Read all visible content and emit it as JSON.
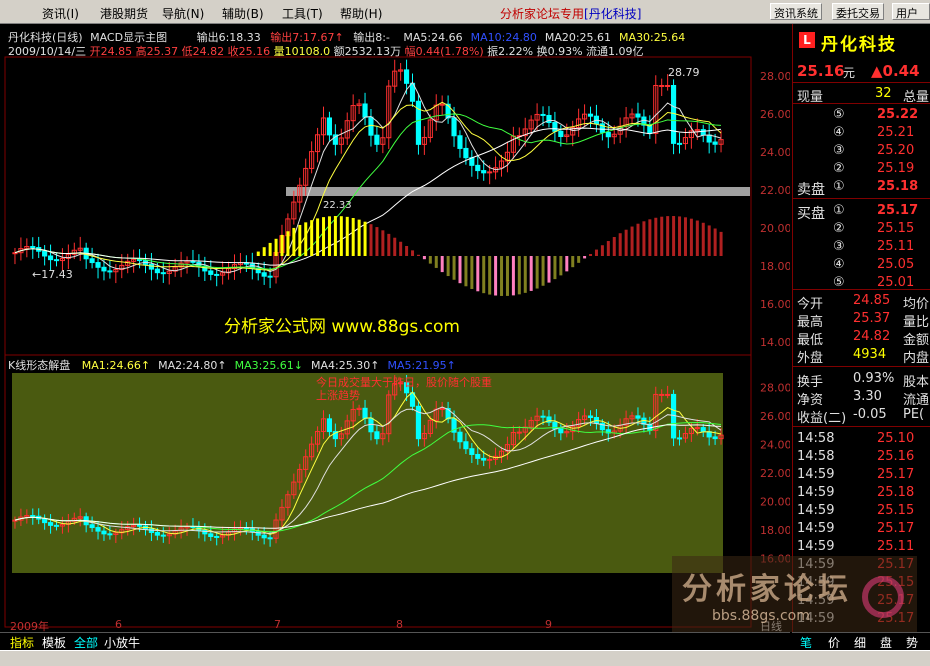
{
  "menu": {
    "items": [
      "资讯(I)",
      "港股期货",
      "导航(N)",
      "辅助(B)",
      "工具(T)",
      "帮助(H)"
    ],
    "forum_label": "分析家论坛专用",
    "stock_tag": "[丹化科技]",
    "buttons": [
      "资讯系统",
      "委托交易",
      "用户"
    ]
  },
  "upper": {
    "title": "丹化科技(日线)",
    "indicator": "MACD显示主图",
    "outputs": [
      "输出6:18.33",
      "输出7:17.67↑",
      "输出8:-"
    ],
    "ma": [
      {
        "label": "MA5:24.66",
        "color": "#e0e0e0"
      },
      {
        "label": "MA10:24.80",
        "color": "#3050ff"
      },
      {
        "label": "MA20:25.61",
        "color": "#e0e0e0"
      },
      {
        "label": "MA30:25.64",
        "color": "#ffff40"
      }
    ],
    "info_line": {
      "date": "2009/10/14/三",
      "open": "开24.85",
      "high": "高25.37",
      "low": "低24.82",
      "close": "收25.16",
      "vol": "量10108.0",
      "amount": "额2532.13万",
      "change": "幅0.44(1.78%)",
      "amp": "振2.22%",
      "turnover": "换0.93%",
      "float": "流通1.09亿"
    },
    "y_ticks": [
      "28.00",
      "26.00",
      "24.00",
      "22.00",
      "20.00",
      "18.00",
      "16.00",
      "14.00"
    ],
    "annotations": {
      "high": "28.79",
      "low": "←17.43",
      "mid": "22.33"
    },
    "watermark": "分析家公式网  www.88gs.com"
  },
  "lower": {
    "title": "K线形态解盘",
    "ma": [
      {
        "label": "MA1:24.66↑",
        "color": "#ffff40"
      },
      {
        "label": "MA2:24.80↑",
        "color": "#e0e0e0"
      },
      {
        "label": "MA3:25.61↓",
        "color": "#40ff40"
      },
      {
        "label": "MA4:25.30↑",
        "color": "#e0e0e0"
      },
      {
        "label": "MA5:21.95↑",
        "color": "#3050ff"
      }
    ],
    "note_lines": [
      "今日成交量大于昨日，股价随个股重",
      "上涨趋势"
    ],
    "y_ticks": [
      "28.00",
      "26.00",
      "24.00",
      "22.00",
      "20.00",
      "18.00",
      "16.00"
    ],
    "x_ticks": [
      "2009年",
      "6",
      "7",
      "8",
      "9"
    ],
    "period": "日线"
  },
  "quote": {
    "name": "丹化科技",
    "logo": "L",
    "price": "25.16",
    "unit": "元",
    "change": "▲0.44",
    "volume_label": "现量",
    "volume": "32",
    "total_label": "总量",
    "sell_label": "卖盘",
    "buy_label": "买盘",
    "asks": [
      {
        "level": "⑤",
        "price": "25.22"
      },
      {
        "level": "④",
        "price": "25.21"
      },
      {
        "level": "③",
        "price": "25.20"
      },
      {
        "level": "②",
        "price": "25.19"
      },
      {
        "level": "①",
        "price": "25.18"
      }
    ],
    "bids": [
      {
        "level": "①",
        "price": "25.17"
      },
      {
        "level": "②",
        "price": "25.15"
      },
      {
        "level": "③",
        "price": "25.11"
      },
      {
        "level": "④",
        "price": "25.05"
      },
      {
        "level": "⑤",
        "price": "25.01"
      }
    ],
    "stats": [
      {
        "label": "今开",
        "value": "24.85",
        "extra": "均价"
      },
      {
        "label": "最高",
        "value": "25.37",
        "extra": "量比"
      },
      {
        "label": "最低",
        "value": "24.82",
        "extra": "金额"
      },
      {
        "label": "外盘",
        "value": "4934",
        "extra": "内盘"
      }
    ],
    "stats2": [
      {
        "label": "换手",
        "value": "0.93%",
        "extra": "股本"
      },
      {
        "label": "净资",
        "value": "3.30",
        "extra": "流通"
      },
      {
        "label": "收益(二)",
        "value": "-0.05",
        "extra": "PE("
      }
    ],
    "ticks": [
      {
        "time": "14:58",
        "price": "25.10"
      },
      {
        "time": "14:58",
        "price": "25.16"
      },
      {
        "time": "14:59",
        "price": "25.17"
      },
      {
        "time": "14:59",
        "price": "25.18"
      },
      {
        "time": "14:59",
        "price": "25.15"
      },
      {
        "time": "14:59",
        "price": "25.17"
      },
      {
        "time": "14:59",
        "price": "25.11"
      },
      {
        "time": "14:59",
        "price": "25.17"
      },
      {
        "time": "14:59",
        "price": "25.15"
      },
      {
        "time": "14:59",
        "price": "25.17"
      },
      {
        "time": "14:59",
        "price": "25.17"
      }
    ]
  },
  "tabs": [
    "指标",
    "模板",
    "全部",
    "小放牛"
  ],
  "quote_tabs": [
    "笔",
    "价",
    "细",
    "盘",
    "势"
  ],
  "watermark": {
    "brand": "分析家论坛",
    "site": "bbs.88gs.com"
  },
  "colors": {
    "up": "#ff3030",
    "down": "#00ffff",
    "panel_bg": "#4a5a10",
    "accent_red": "#ff2020",
    "yellow": "#ffff00"
  }
}
